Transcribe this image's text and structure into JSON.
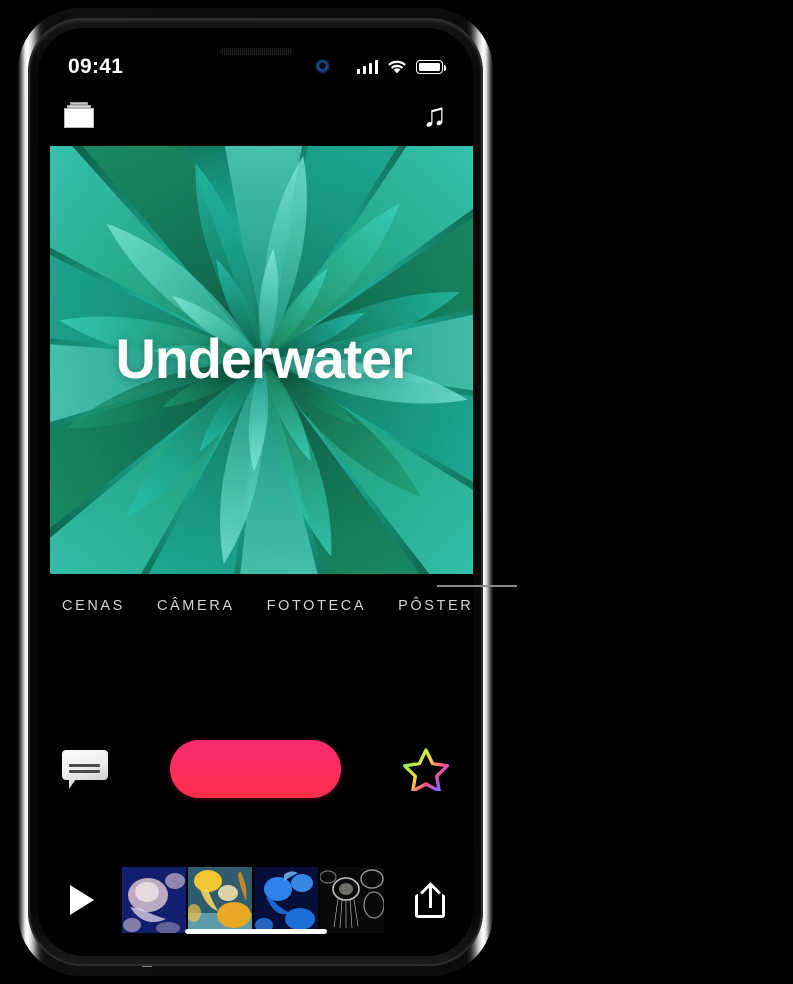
{
  "status_bar": {
    "time": "09:41",
    "signal_icon": "cellular-signal-icon",
    "signal_bars": 4,
    "wifi_icon": "wifi-icon",
    "battery_icon": "battery-icon",
    "battery_level": 100
  },
  "app_bar": {
    "projects_icon": "projects-stack-icon",
    "music_icon": "music-note-icon",
    "music_glyph": "♫"
  },
  "poster": {
    "title": "Underwater",
    "theme": "radial-petal-bloom",
    "colors": {
      "teal_light": "#4fe3cf",
      "teal": "#17c2b0",
      "green": "#1f8a52",
      "green_dark": "#0c4f33",
      "cyan": "#3fd8de"
    }
  },
  "tabs": [
    {
      "label": "CENAS",
      "name": "tab-cenas",
      "selected": false
    },
    {
      "label": "CÂMERA",
      "name": "tab-camera",
      "selected": false
    },
    {
      "label": "FOTOTECA",
      "name": "tab-fototeca",
      "selected": false
    },
    {
      "label": "PÔSTERES",
      "name": "tab-posteres",
      "selected": true
    }
  ],
  "controls": {
    "titles_icon": "speech-bubble-titles-icon",
    "record_button_label": "",
    "record_button_name": "record-button",
    "record_color_start": "#FA2A72",
    "record_color_end": "#FF2F49",
    "filters_icon": "rainbow-star-filters-icon"
  },
  "timeline": {
    "play_icon": "play-icon",
    "share_icon": "share-icon",
    "clips": [
      {
        "name": "clip-thumbnail-1",
        "description": "purple jellyfish on deep blue"
      },
      {
        "name": "clip-thumbnail-2",
        "description": "yellow-orange jellyfish"
      },
      {
        "name": "clip-thumbnail-3",
        "description": "bright blue jellyfish"
      },
      {
        "name": "clip-thumbnail-4",
        "description": "white translucent jellyfish on black"
      }
    ]
  },
  "annotation": {
    "callout_target": "PÔSTERES",
    "callout_name": "callout-leader-line"
  },
  "device": {
    "frame_color": "#e9e9e9",
    "home_indicator": "home-indicator"
  }
}
